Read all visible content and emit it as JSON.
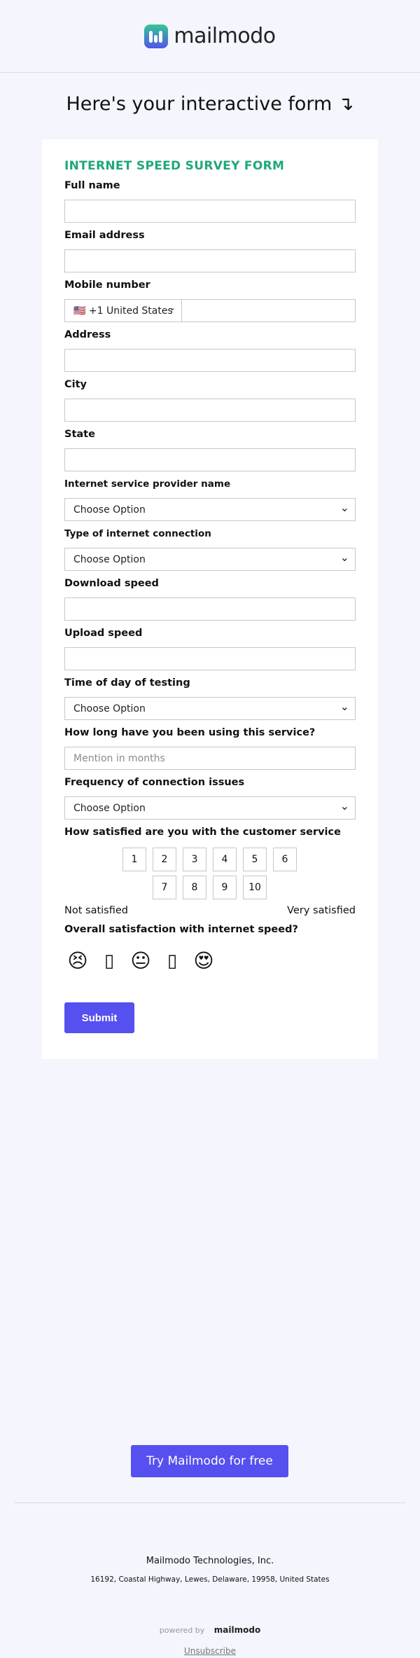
{
  "brand": {
    "name": "mailmodo"
  },
  "intro": {
    "text": "Here's your interactive form ↴"
  },
  "form": {
    "title": "INTERNET SPEED SURVEY FORM",
    "full_name_label": "Full name",
    "email_label": "Email address",
    "mobile_label": "Mobile number",
    "mobile_country": "🇺🇸 +1 United States",
    "address_label": "Address",
    "city_label": "City",
    "state_label": "State",
    "isp_label": "Internet service provider name",
    "isp_value": "Choose Option",
    "conn_type_label": "Type of internet connection",
    "conn_type_value": "Choose Option",
    "download_label": "Download speed",
    "upload_label": "Upload speed",
    "time_label": "Time of day of testing",
    "time_value": "Choose Option",
    "duration_label": "How long have you been using this service?",
    "duration_placeholder": "Mention in months",
    "frequency_label": "Frequency of connection issues",
    "frequency_value": "Choose Option",
    "satisfaction_label": "How satisfied are you with the customer service",
    "ratings": [
      "1",
      "2",
      "3",
      "4",
      "5",
      "6",
      "7",
      "8",
      "9",
      "10"
    ],
    "rating_low": "Not satisfied",
    "rating_high": "Very satisfied",
    "speed_label": "Overall satisfaction with internet speed?",
    "emojis": [
      "😣",
      "▯",
      "😐",
      "▯",
      "😍"
    ],
    "submit_label": "Submit"
  },
  "footer": {
    "cta_label": "Try Mailmodo for free",
    "company": "Mailmodo Technologies, Inc.",
    "address": "16192, Coastal Highway, Lewes, Delaware, 19958, United States",
    "powered_by": "powered by",
    "powered_brand": "mailmodo",
    "unsubscribe": "Unsubscribe"
  },
  "colors": {
    "accent": "#5550ef",
    "title_green": "#20a87a",
    "background": "#f4f5fd"
  }
}
